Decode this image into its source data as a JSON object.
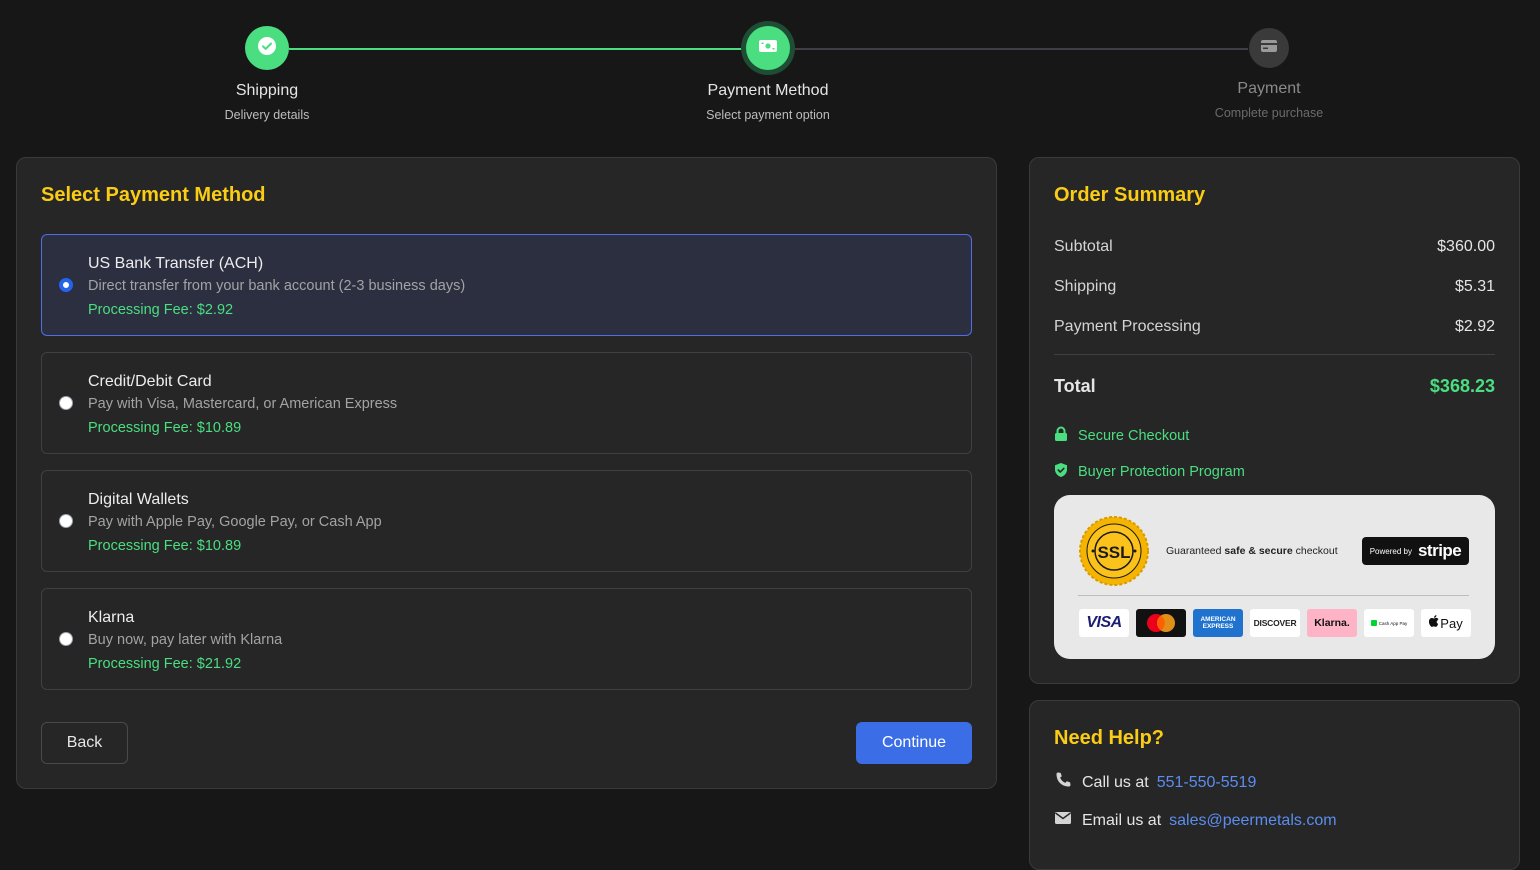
{
  "stepper": {
    "steps": [
      {
        "title": "Shipping",
        "subtitle": "Delivery details",
        "state": "done",
        "icon": "check-icon"
      },
      {
        "title": "Payment Method",
        "subtitle": "Select payment option",
        "state": "active",
        "icon": "banknote-icon"
      },
      {
        "title": "Payment",
        "subtitle": "Complete purchase",
        "state": "todo",
        "icon": "credit-card-icon"
      }
    ]
  },
  "payment": {
    "title": "Select Payment Method",
    "selected": 0,
    "options": [
      {
        "title": "US Bank Transfer (ACH)",
        "description": "Direct transfer from your bank account (2-3 business days)",
        "fee": "Processing Fee: $2.92"
      },
      {
        "title": "Credit/Debit Card",
        "description": "Pay with Visa, Mastercard, or American Express",
        "fee": "Processing Fee: $10.89"
      },
      {
        "title": "Digital Wallets",
        "description": "Pay with Apple Pay, Google Pay, or Cash App",
        "fee": "Processing Fee: $10.89"
      },
      {
        "title": "Klarna",
        "description": "Buy now, pay later with Klarna",
        "fee": "Processing Fee: $21.92"
      }
    ],
    "back_label": "Back",
    "continue_label": "Continue"
  },
  "summary": {
    "title": "Order Summary",
    "rows": [
      {
        "label": "Subtotal",
        "value": "$360.00"
      },
      {
        "label": "Shipping",
        "value": "$5.31"
      },
      {
        "label": "Payment Processing",
        "value": "$2.92"
      }
    ],
    "total_label": "Total",
    "total_value": "$368.23",
    "secure_checkout": "Secure Checkout",
    "buyer_protection": "Buyer Protection Program",
    "trust": {
      "guarantee_prefix": "Guaranteed ",
      "guarantee_bold": "safe & secure",
      "guarantee_suffix": " checkout",
      "powered_by": "Powered by",
      "stripe": "stripe",
      "ssl": "SSL",
      "cards": [
        "VISA",
        "Mastercard",
        "AMERICAN EXPRESS",
        "DISCOVER",
        "Klarna.",
        "Cash App Pay",
        "Pay"
      ]
    }
  },
  "help": {
    "title": "Need Help?",
    "call_label": "Call us at",
    "phone": "551-550-5519",
    "email_label": "Email us at",
    "email": "sales@peermetals.com"
  },
  "colors": {
    "accent_yellow": "#facc15",
    "success_green": "#4ade80",
    "primary_blue": "#3b6ee6",
    "link_blue": "#5b8def"
  }
}
